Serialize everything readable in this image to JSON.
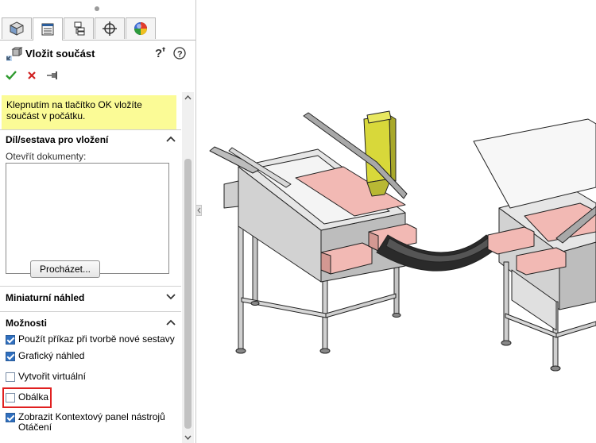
{
  "panel": {
    "title": "Vložit součást",
    "tabs": [
      "feature-manager",
      "property-manager",
      "configuration-manager",
      "dimxpert-manager",
      "display-manager"
    ],
    "active_tab": 1,
    "message": "Klepnutím na tlačítko OK vložíte součást v počátku.",
    "sections": {
      "part_assembly": {
        "title": "Díl/sestava pro vložení",
        "open_docs_label": "Otevřít dokumenty:",
        "browse_label": "Procházet..."
      },
      "thumbnail": {
        "title": "Miniaturní náhled"
      },
      "options": {
        "title": "Možnosti",
        "items": [
          {
            "label": "Použít příkaz při tvorbě nové sestavy",
            "checked": true
          },
          {
            "label": "Grafický náhled",
            "checked": true
          },
          {
            "label": "Vytvořit virtuální",
            "checked": false
          },
          {
            "label": "Obálka",
            "checked": false
          },
          {
            "label": "Zobrazit Kontextový panel nástrojů Otáčení",
            "checked": true
          }
        ]
      }
    }
  },
  "colors": {
    "message_bg": "#fbfb96",
    "ok_green": "#2e9a2e",
    "cancel_red": "#d02020",
    "highlight_red": "#e02020",
    "checkbox_blue": "#2f6fbf",
    "part_pink": "#f2b9b4",
    "hopper_yellow": "#d8d83a"
  }
}
